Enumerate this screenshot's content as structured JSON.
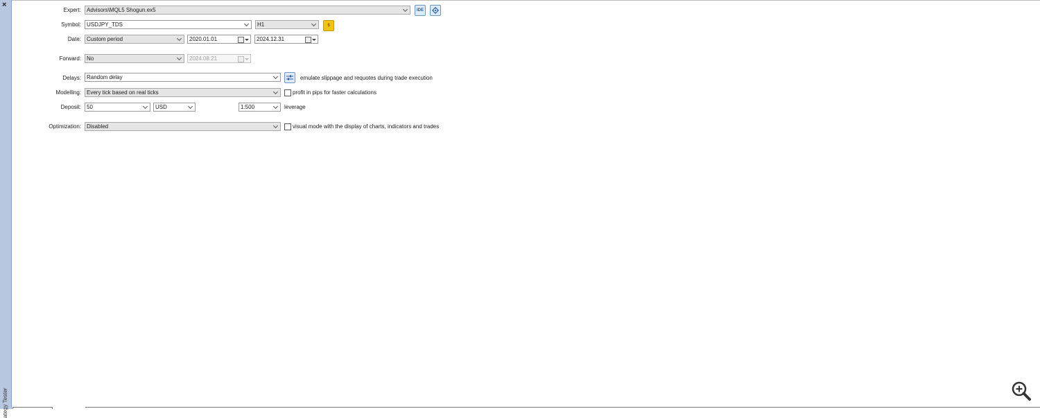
{
  "window": {
    "close_symbol": "×",
    "panel_title": "ategy Tester"
  },
  "expert": {
    "label": "Expert:",
    "value": "Advisors\\MQL5 Shogun.ex5",
    "ide_button": "IDE",
    "settings_icon": "gear-icon"
  },
  "symbol": {
    "label": "Symbol:",
    "value": "USDJPY_TDS",
    "timeframe": "H1",
    "spec_button": "$"
  },
  "date": {
    "label": "Date:",
    "period": "Custom period",
    "from": "2020.01.01",
    "to": "2024.12.31"
  },
  "forward": {
    "label": "Forward:",
    "value": "No",
    "date": "2024.08.21"
  },
  "delays": {
    "label": "Delays:",
    "value": "Random delay",
    "settings_icon": "sliders-icon",
    "note": "emulate slippage and requotes during trade execution"
  },
  "modelling": {
    "label": "Modelling:",
    "value": "Every tick based on real ticks",
    "checkbox_label": "profit in pips for faster calculations",
    "checked": false
  },
  "deposit": {
    "label": "Deposit:",
    "amount": "50",
    "currency": "USD",
    "leverage_value": "1:500",
    "leverage_label": "leverage"
  },
  "optimization": {
    "label": "Optimization:",
    "value": "Disabled",
    "checkbox_label": "visual mode with the display of charts, indicators and trades",
    "checked": false
  },
  "accent": {
    "sidebar": "#b7c7e0",
    "ide_blue": "#2a5ea3",
    "coin_yellow": "#f1c40f"
  },
  "zoom_icon": "zoom-in-icon"
}
